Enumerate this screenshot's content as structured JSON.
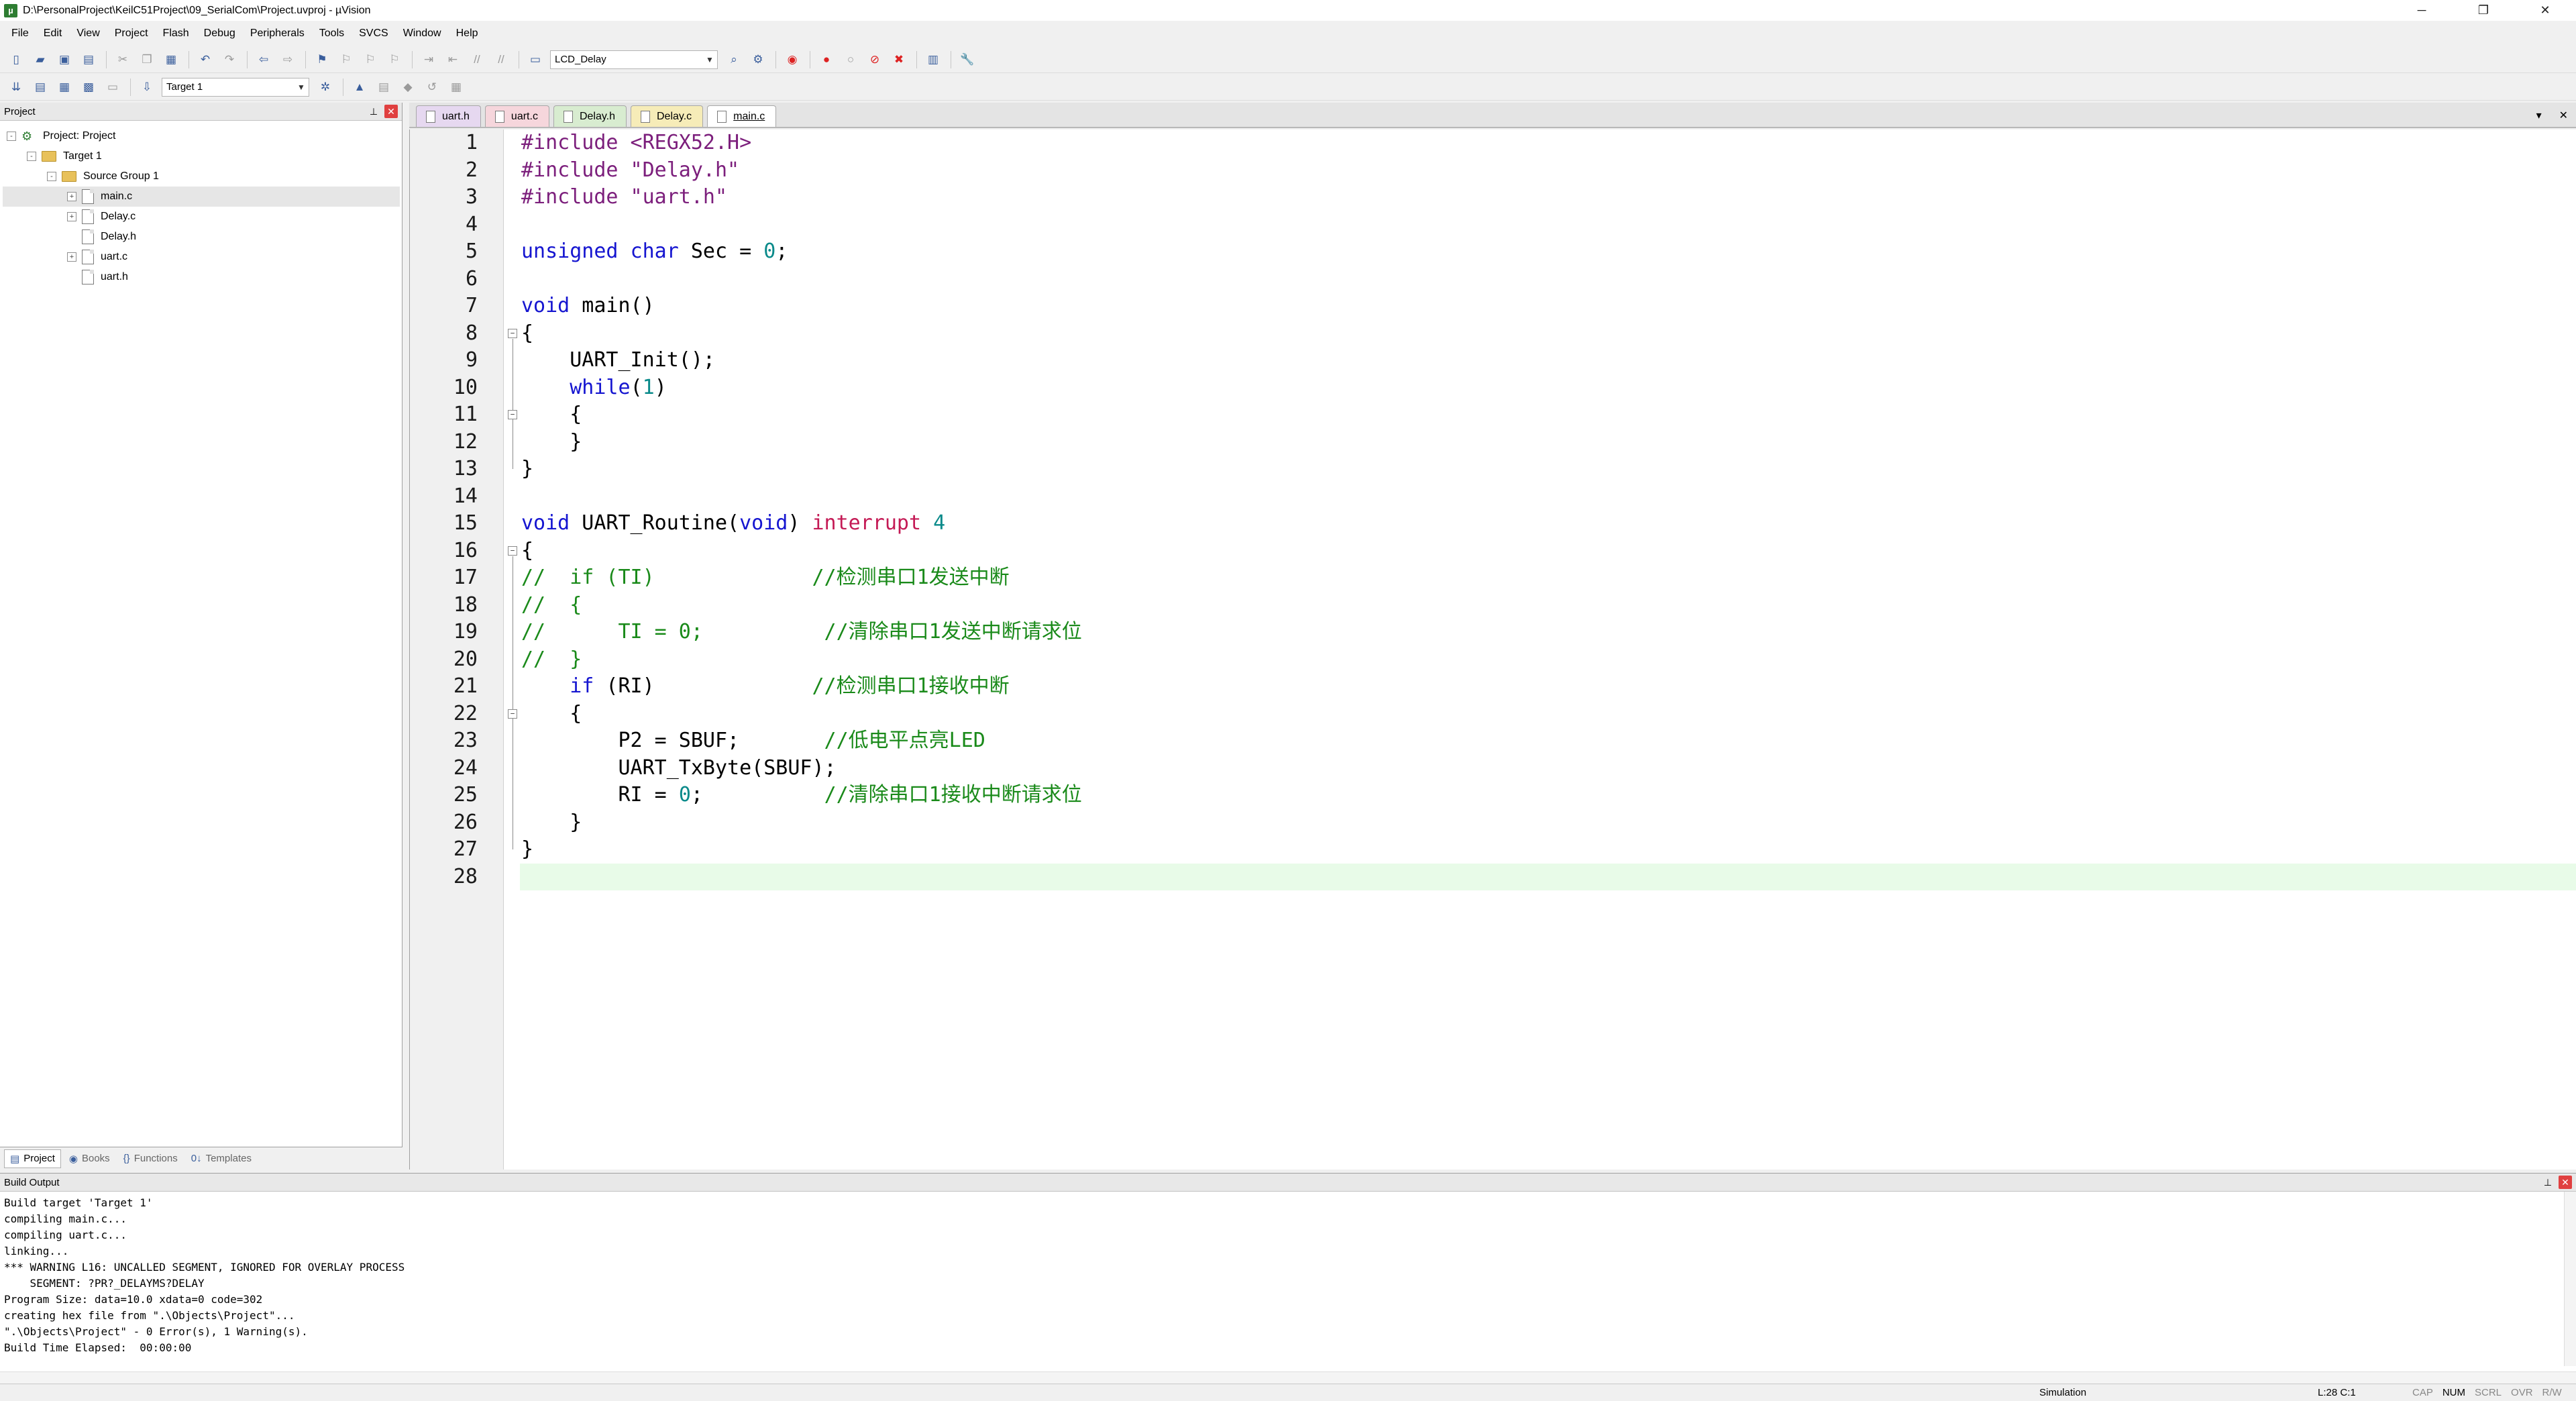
{
  "window": {
    "title": "D:\\PersonalProject\\KeilC51Project\\09_SerialCom\\Project.uvproj - µVision",
    "app_icon": "keil-uvision-icon",
    "buttons": [
      "─",
      "❐",
      "✕"
    ]
  },
  "menu": [
    "File",
    "Edit",
    "View",
    "Project",
    "Flash",
    "Debug",
    "Peripherals",
    "Tools",
    "SVCS",
    "Window",
    "Help"
  ],
  "toolbar": {
    "combo_function": "LCD_Delay",
    "combo_target": "Target 1"
  },
  "project_panel": {
    "title": "Project",
    "tree": [
      {
        "label": "Project: Project",
        "level": 0,
        "icon": "project-icon",
        "expand": "-"
      },
      {
        "label": "Target 1",
        "level": 1,
        "icon": "folder-icon",
        "expand": "-"
      },
      {
        "label": "Source Group 1",
        "level": 2,
        "icon": "folder-icon",
        "expand": "-"
      },
      {
        "label": "main.c",
        "level": 3,
        "icon": "file-icon",
        "expand": "+",
        "selected": true
      },
      {
        "label": "Delay.c",
        "level": 3,
        "icon": "file-icon",
        "expand": "+"
      },
      {
        "label": "Delay.h",
        "level": 3,
        "icon": "file-icon",
        "expand": ""
      },
      {
        "label": "uart.c",
        "level": 3,
        "icon": "file-icon",
        "expand": "+"
      },
      {
        "label": "uart.h",
        "level": 3,
        "icon": "file-icon",
        "expand": ""
      }
    ],
    "tabs": [
      {
        "label": "Project",
        "icon": "project-tab-icon",
        "active": true
      },
      {
        "label": "Books",
        "icon": "books-icon"
      },
      {
        "label": "Functions",
        "icon": "functions-icon"
      },
      {
        "label": "Templates",
        "icon": "templates-icon"
      }
    ]
  },
  "editor": {
    "tabs": [
      {
        "label": "uart.h",
        "color": "#e6d8f0"
      },
      {
        "label": "uart.c",
        "color": "#f6d6dc"
      },
      {
        "label": "Delay.h",
        "color": "#d8ecd0"
      },
      {
        "label": "Delay.c",
        "color": "#f6ecb8"
      },
      {
        "label": "main.c",
        "color": "#ffffff",
        "active": true
      }
    ],
    "tab_menu": "▾",
    "tab_close": "✕",
    "current_line": 28,
    "lines": [
      "#include <REGX52.H>",
      "#include \"Delay.h\"",
      "#include \"uart.h\"",
      "",
      "unsigned char Sec = 0;",
      "",
      "void main()",
      "{",
      "    UART_Init();",
      "    while(1)",
      "    {",
      "    }",
      "}",
      "",
      "void UART_Routine(void) interrupt 4",
      "{",
      "//  if (TI)             //检测串口1发送中断",
      "//  {",
      "//      TI = 0;          //清除串口1发送中断请求位",
      "//  }",
      "    if (RI)             //检测串口1接收中断",
      "    {",
      "        P2 = SBUF;       //低电平点亮LED",
      "        UART_TxByte(SBUF);",
      "        RI = 0;          //清除串口1接收中断请求位",
      "    }",
      "}",
      ""
    ]
  },
  "build_output": {
    "title": "Build Output",
    "lines": [
      "Build target 'Target 1'",
      "compiling main.c...",
      "compiling uart.c...",
      "linking...",
      "*** WARNING L16: UNCALLED SEGMENT, IGNORED FOR OVERLAY PROCESS",
      "    SEGMENT: ?PR?_DELAYMS?DELAY",
      "Program Size: data=10.0 xdata=0 code=302",
      "creating hex file from \".\\Objects\\Project\"...",
      "\".\\Objects\\Project\" - 0 Error(s), 1 Warning(s).",
      "Build Time Elapsed:  00:00:00"
    ]
  },
  "status": {
    "mode": "Simulation",
    "position": "L:28 C:1",
    "flags": [
      {
        "label": "CAP",
        "on": false
      },
      {
        "label": "NUM",
        "on": true
      },
      {
        "label": "SCRL",
        "on": false
      },
      {
        "label": "OVR",
        "on": false
      },
      {
        "label": "R/W",
        "on": false
      }
    ]
  }
}
